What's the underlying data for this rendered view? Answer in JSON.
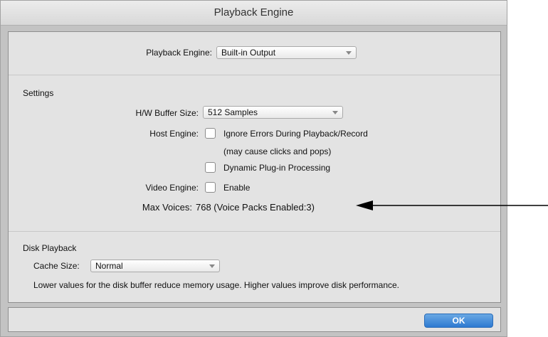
{
  "window": {
    "title": "Playback Engine"
  },
  "engine": {
    "label": "Playback Engine:",
    "value": "Built-in Output"
  },
  "settings": {
    "heading": "Settings",
    "buffer": {
      "label": "H/W Buffer Size:",
      "value": "512 Samples"
    },
    "host_engine": {
      "label": "Host Engine:",
      "ignore_errors": "Ignore Errors During Playback/Record",
      "ignore_errors_note": "(may cause clicks and pops)",
      "dynamic_plugin": "Dynamic Plug-in Processing"
    },
    "video_engine": {
      "label": "Video Engine:",
      "enable": "Enable"
    },
    "max_voices": {
      "label": "Max Voices:",
      "value": "768 (Voice Packs Enabled:3)"
    }
  },
  "disk": {
    "heading": "Disk Playback",
    "cache": {
      "label": "Cache Size:",
      "value": "Normal"
    },
    "note": "Lower values for the disk buffer reduce memory usage.  Higher values improve disk performance."
  },
  "buttons": {
    "ok": "OK"
  }
}
